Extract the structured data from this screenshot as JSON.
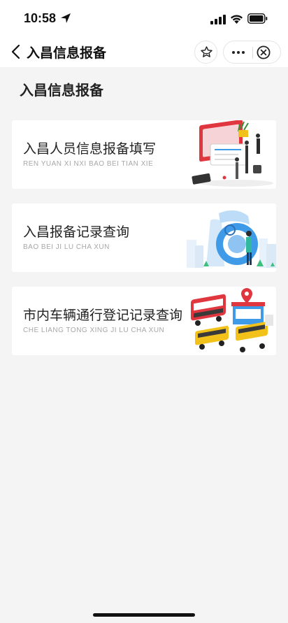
{
  "status_bar": {
    "time": "10:58",
    "icons": [
      "location-arrow-icon",
      "signal-icon",
      "wifi-icon",
      "battery-icon"
    ]
  },
  "nav_bar": {
    "title": "入昌信息报备",
    "icons": [
      "back-icon",
      "star-icon",
      "more-icon",
      "close-icon"
    ]
  },
  "page": {
    "heading": "入昌信息报备"
  },
  "cards": [
    {
      "title": "入昌人员信息报备填写",
      "subtitle": "REN YUAN XI NXI BAO BEI TIAN XIE"
    },
    {
      "title": "入昌报备记录查询",
      "subtitle": "BAO BEI JI LU CHA XUN"
    },
    {
      "title": "市内车辆通行登记记录查询",
      "subtitle": "CHE LIANG TONG XING JI LU CHA XUN"
    }
  ],
  "colors": {
    "background": "#f4f4f4",
    "card": "#ffffff",
    "subtitle": "#a7a7a7",
    "accent_red": "#e0363f",
    "accent_blue": "#3f9be8",
    "accent_yellow": "#f2c21b"
  }
}
